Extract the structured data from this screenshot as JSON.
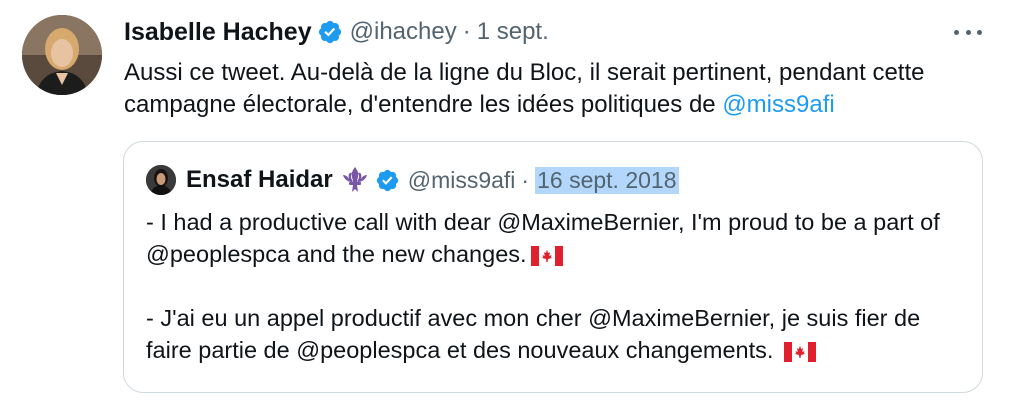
{
  "tweet": {
    "author_name": "Isabelle Hachey",
    "handle": "@ihachey",
    "separator": "·",
    "time": "1 sept.",
    "text_before_link": "Aussi ce tweet. Au-delà de la ligne du Bloc, il serait pertinent, pendant cette campagne électorale, d'entendre les idées politiques de ",
    "link_text": "@miss9afi"
  },
  "quoted_tweet": {
    "author_name": "Ensaf Haidar",
    "handle": "@miss9afi",
    "separator": "·",
    "time": "16 sept. 2018",
    "paragraph_1": "- I had a productive call with dear @MaximeBernier, I'm proud to be a part of @peoplespca and the new changes.",
    "paragraph_2": "- J'ai eu un appel productif avec mon cher @MaximeBernier, je suis fier de faire partie de @peoplespca et des nouveaux changements. "
  },
  "icons": {
    "verified": "verified-badge-icon",
    "more": "more-options-icon",
    "fleur": "fleur-de-lis-icon",
    "flag": "canada-flag-icon"
  },
  "colors": {
    "accent": "#1d9bf0",
    "secondary_text": "#536471",
    "border": "#cfd9de",
    "highlight": "#b3d7fb",
    "fleur": "#7856a8",
    "flag_red": "#e0202c"
  }
}
